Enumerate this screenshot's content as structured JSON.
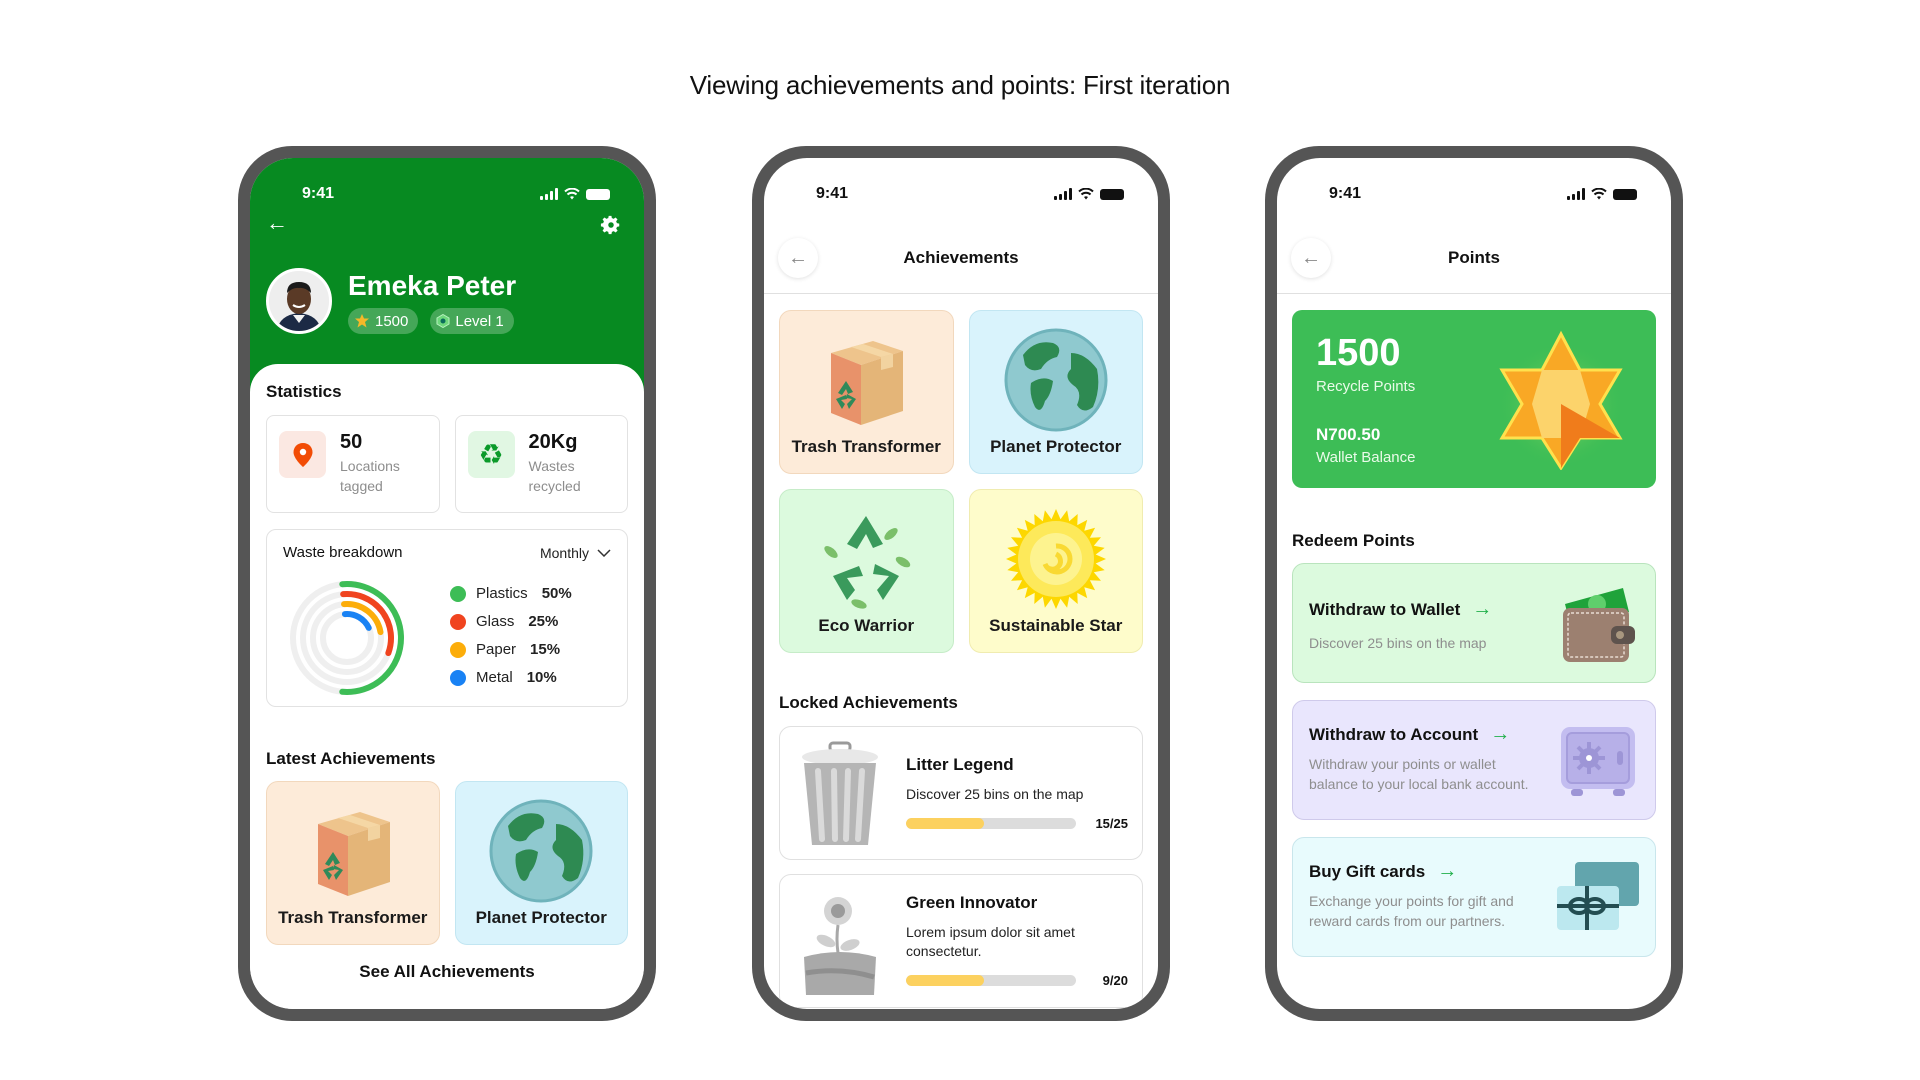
{
  "page": {
    "title": "Viewing achievements and points: First iteration"
  },
  "status_bar": {
    "time": "9:41"
  },
  "profile": {
    "name": "Emeka Peter",
    "points_badge": "1500",
    "level_badge": "Level 1",
    "header_color": "#078a21",
    "statistics_title": "Statistics",
    "stats": [
      {
        "value": "50",
        "label_line1": "Locations",
        "label_line2": "tagged",
        "icon": "location-pin-icon"
      },
      {
        "value": "20Kg",
        "label_line1": "Wastes",
        "label_line2": "recycled",
        "icon": "recycle-icon"
      }
    ],
    "waste_breakdown": {
      "title": "Waste breakdown",
      "period": "Monthly",
      "items": [
        {
          "label": "Plastics",
          "percent": "50%",
          "value": 50,
          "color": "#3dbd56"
        },
        {
          "label": "Glass",
          "percent": "25%",
          "value": 25,
          "color": "#f0441f"
        },
        {
          "label": "Paper",
          "percent": "15%",
          "value": 15,
          "color": "#fcad0a"
        },
        {
          "label": "Metal",
          "percent": "10%",
          "value": 10,
          "color": "#1982f4"
        }
      ]
    },
    "latest_achievements_title": "Latest Achievements",
    "latest_achievements": [
      {
        "name": "Trash Transformer"
      },
      {
        "name": "Planet Protector"
      }
    ],
    "see_all": "See All Achievements"
  },
  "achievements": {
    "title": "Achievements",
    "unlocked": [
      {
        "name": "Trash Transformer"
      },
      {
        "name": "Planet Protector"
      },
      {
        "name": "Eco Warrior"
      },
      {
        "name": "Sustainable Star"
      }
    ],
    "locked_title": "Locked Achievements",
    "locked": [
      {
        "name": "Litter Legend",
        "desc": "Discover 25 bins on the map",
        "progress": 0.46,
        "current": "15",
        "total": "25"
      },
      {
        "name": "Green Innovator",
        "desc": "Lorem ipsum dolor sit amet consectetur.",
        "progress": 0.46,
        "current": "9",
        "total": "20"
      }
    ]
  },
  "points": {
    "title": "Points",
    "recycle_points": "1500",
    "recycle_points_label": "Recycle Points",
    "wallet_balance": "N700.50",
    "wallet_balance_label": "Wallet Balance",
    "redeem_title": "Redeem Points",
    "redeem": [
      {
        "title": "Withdraw to Wallet",
        "desc": "Discover 25 bins on the map"
      },
      {
        "title": "Withdraw to Account",
        "desc": "Withdraw your points or wallet balance to your local bank account."
      },
      {
        "title": "Buy Gift cards",
        "desc": "Exchange your points for gift and reward cards from our partners."
      }
    ],
    "arrow": "→"
  }
}
